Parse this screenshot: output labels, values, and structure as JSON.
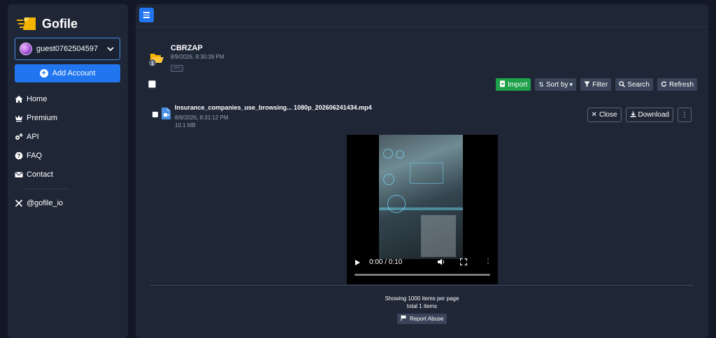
{
  "brand": {
    "name": "Gofile"
  },
  "account": {
    "username": "guest0762504597",
    "add_label": "Add Account"
  },
  "nav": [
    {
      "label": "Home",
      "icon": "home-icon"
    },
    {
      "label": "Premium",
      "icon": "crown-icon"
    },
    {
      "label": "API",
      "icon": "gears-icon"
    },
    {
      "label": "FAQ",
      "icon": "question-icon"
    },
    {
      "label": "Contact",
      "icon": "envelope-icon"
    }
  ],
  "social": {
    "label": "@gofile_io",
    "icon": "x-logo-icon"
  },
  "folder": {
    "name": "CBRZAP",
    "date": "8/9/2026, 8:30:39 PM",
    "badge": "1",
    "more_label": "···"
  },
  "toolbar": {
    "import": "Import",
    "sort": "Sort by",
    "filter": "Filter",
    "search": "Search",
    "refresh": "Refresh"
  },
  "file": {
    "name": "Insurance_companies_use_browsing... 1080p_202606241434.mp4",
    "date": "8/9/2026, 8:31:12 PM",
    "size": "10.1 MB",
    "close_label": "Close",
    "download_label": "Download"
  },
  "player": {
    "time": "0:00 / 0:10"
  },
  "footer": {
    "showing": "Showing 1000 items per page",
    "total": "total 1 items",
    "report": "Report Abuse"
  },
  "colors": {
    "accent": "#2176f0",
    "import": "#1ea14a",
    "background": "#1f2737"
  }
}
